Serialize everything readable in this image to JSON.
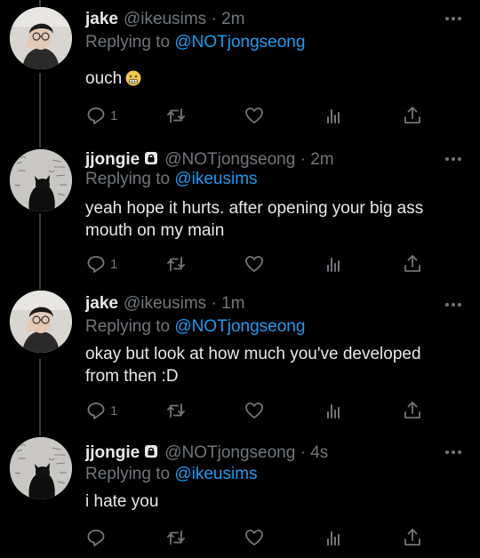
{
  "tweets": [
    {
      "name": "jake",
      "handle": "@ikeusims",
      "time": "2m",
      "reply_prefix": "Replying to",
      "reply_to": "@NOTjongseong",
      "text": "ouch",
      "emoji": "grimacing-face-emoji",
      "locked": false,
      "reply_count": "1",
      "avatar": "jake-avatar"
    },
    {
      "name": "jjongie",
      "handle": "@NOTjongseong",
      "time": "2m",
      "reply_prefix": "Replying to",
      "reply_to": "@ikeusims",
      "text": "yeah hope it hurts. after opening your big ass mouth on my main",
      "locked": true,
      "reply_count": "1",
      "avatar": "black-cat-avatar"
    },
    {
      "name": "jake",
      "handle": "@ikeusims",
      "time": "1m",
      "reply_prefix": "Replying to",
      "reply_to": "@NOTjongseong",
      "text": "okay but look at how much you've developed from then :D",
      "locked": false,
      "reply_count": "1",
      "avatar": "jake-avatar"
    },
    {
      "name": "jjongie",
      "handle": "@NOTjongseong",
      "time": "4s",
      "reply_prefix": "Replying to",
      "reply_to": "@ikeusims",
      "text": "i hate you",
      "locked": true,
      "reply_count": "",
      "avatar": "black-cat-avatar"
    }
  ],
  "separator": "·",
  "icons": {
    "reply": "reply-icon",
    "retweet": "retweet-icon",
    "like": "heart-icon",
    "views": "analytics-icon",
    "share": "share-icon",
    "more": "more-icon",
    "lock": "lock-icon"
  },
  "colors": {
    "background": "#000000",
    "text": "#e7e9ea",
    "muted": "#71767b",
    "mention": "#1d9bf0",
    "thread_line": "#3a3d40"
  }
}
